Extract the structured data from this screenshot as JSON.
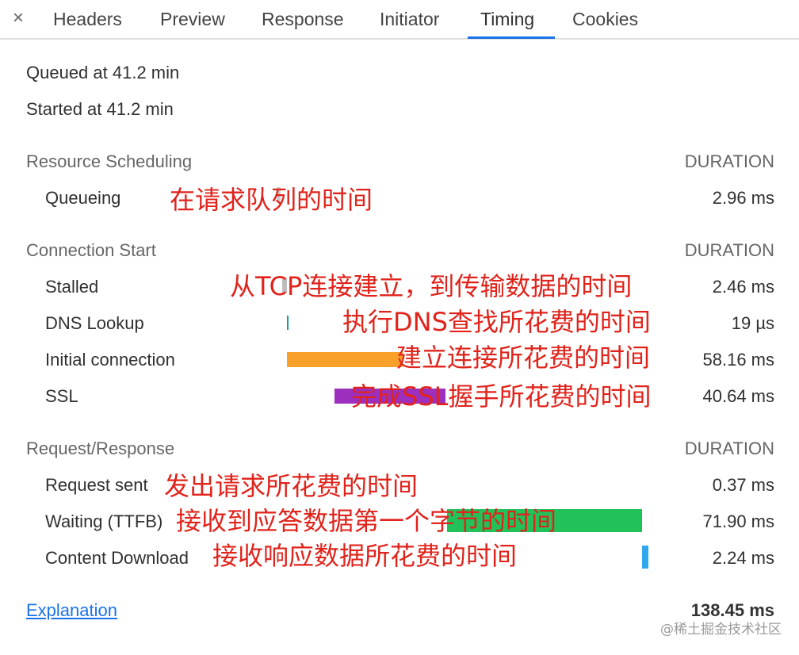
{
  "tabs": {
    "close": "×",
    "headers": "Headers",
    "preview": "Preview",
    "response": "Response",
    "initiator": "Initiator",
    "timing": "Timing",
    "cookies": "Cookies",
    "active": "Timing"
  },
  "summary": {
    "queued": "Queued at 41.2 min",
    "started": "Started at 41.2 min"
  },
  "sections": {
    "scheduling": {
      "title": "Resource Scheduling",
      "duration_label": "DURATION",
      "rows": [
        {
          "label": "Queueing",
          "value": "2.96 ms",
          "annotation": "在请求队列的时间"
        }
      ]
    },
    "connection": {
      "title": "Connection Start",
      "duration_label": "DURATION",
      "rows": [
        {
          "label": "Stalled",
          "value": "2.46 ms",
          "annotation": "从TCP连接建立，到传输数据的时间"
        },
        {
          "label": "DNS Lookup",
          "value": "19 µs",
          "annotation": "执行DNS查找所花费的时间"
        },
        {
          "label": "Initial connection",
          "value": "58.16 ms",
          "annotation": "建立连接所花费的时间"
        },
        {
          "label": "SSL",
          "value": "40.64 ms",
          "annotation": "完成SSL握手所花费的时间"
        }
      ]
    },
    "request": {
      "title": "Request/Response",
      "duration_label": "DURATION",
      "rows": [
        {
          "label": "Request sent",
          "value": "0.37 ms",
          "annotation": "发出请求所花费的时间"
        },
        {
          "label": "Waiting (TTFB)",
          "value": "71.90 ms",
          "annotation": "接收到应答数据第一个字节的时间"
        },
        {
          "label": "Content Download",
          "value": "2.24 ms",
          "annotation": "接收响应数据所花费的时间"
        }
      ]
    }
  },
  "footer": {
    "explanation": "Explanation",
    "total": "138.45 ms"
  },
  "watermark": "@稀土掘金技术社区",
  "colors": {
    "queueing_bar": "#cccccc",
    "stalled_bar": "#bdbdbd",
    "dns_bar": "#1b9e8e",
    "initial_connection_bar": "#f8a02a",
    "ssl_bar": "#9c2fbd",
    "ttfb_bar": "#21c25a",
    "download_bar": "#2fa8ee",
    "annotation": "#e0231b",
    "link": "#1a73e8"
  }
}
